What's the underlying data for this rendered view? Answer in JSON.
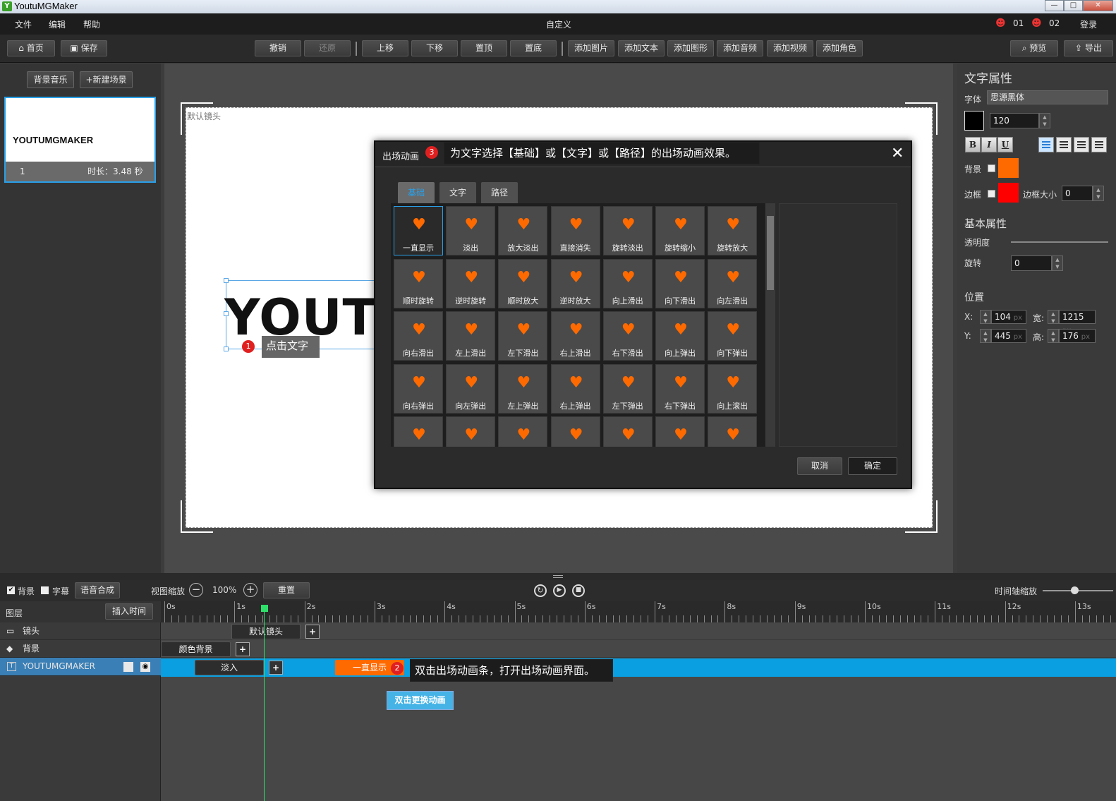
{
  "window": {
    "title": "YoutuMGMaker",
    "icon": "app-icon"
  },
  "menubar": {
    "items": [
      "文件",
      "编辑",
      "帮助"
    ],
    "center_title": "自定义",
    "user1": "01",
    "user2": "02",
    "login": "登录"
  },
  "toolbar": {
    "home": "首页",
    "save": "保存",
    "undo": "撤销",
    "redo": "还原",
    "move_up": "上移",
    "move_down": "下移",
    "to_top": "置顶",
    "to_bottom": "置底",
    "add_image": "添加图片",
    "add_text": "添加文本",
    "add_shape": "添加图形",
    "add_audio": "添加音频",
    "add_video": "添加视频",
    "add_character": "添加角色",
    "preview": "预览",
    "export": "导出"
  },
  "left": {
    "bg_music": "背景音乐",
    "new_scene": "+新建场景",
    "scene_text": "YOUTUMGMAKER",
    "scene_index": "1",
    "scene_duration": "时长：3.48 秒"
  },
  "stage": {
    "camera_label": "默认镜头",
    "text_content": "YOUTU",
    "tip1_num": "1",
    "tip1": "点击文字"
  },
  "dialog": {
    "title": "出场动画",
    "tip3_num": "3",
    "tip3": "为文字选择【基础】或【文字】或【路径】的出场动画效果。",
    "tabs": [
      "基础",
      "文字",
      "路径"
    ],
    "cells": [
      "一直显示",
      "淡出",
      "放大淡出",
      "直接消失",
      "旋转淡出",
      "旋转缩小",
      "旋转放大",
      "顺时旋转",
      "逆时旋转",
      "顺时放大",
      "逆时放大",
      "向上滑出",
      "向下滑出",
      "向左滑出",
      "向右滑出",
      "左上滑出",
      "左下滑出",
      "右上滑出",
      "右下滑出",
      "向上弹出",
      "向下弹出",
      "向右弹出",
      "向左弹出",
      "左上弹出",
      "右上弹出",
      "左下弹出",
      "右下弹出",
      "向上滚出",
      "",
      "",
      "",
      "",
      "",
      "",
      ""
    ],
    "cancel": "取消",
    "ok": "确定"
  },
  "right": {
    "title": "文字属性",
    "font_label": "字体",
    "font_value": "思源黑体",
    "size": "120",
    "bold": "B",
    "italic": "I",
    "underline": "U",
    "bg_label": "背景",
    "border_label": "边框",
    "border_size_label": "边框大小",
    "border_size": "0",
    "basic_title": "基本属性",
    "opacity_label": "透明度",
    "rotate_label": "旋转",
    "rotate": "0",
    "position_title": "位置",
    "x_label": "X:",
    "x": "104",
    "y_label": "Y:",
    "y": "445",
    "w_label": "宽:",
    "w": "1215",
    "h_label": "高:",
    "h": "176",
    "unit": "px",
    "bg_color": "#ff6a00",
    "border_color": "#ff0000",
    "text_color": "#000000"
  },
  "timeline": {
    "bg_check": "背景",
    "subtitle_check": "字幕",
    "tts": "语音合成",
    "zoom_label": "视图缩放",
    "zoom": "100%",
    "reset": "重置",
    "timescale": "时间轴缩放",
    "layers_label": "图层",
    "insert_time": "插入时间",
    "ticks": [
      "0s",
      "1s",
      "2s",
      "3s",
      "4s",
      "5s",
      "6s",
      "7s",
      "8s",
      "9s",
      "10s",
      "11s",
      "12s",
      "13s"
    ],
    "rows": [
      {
        "name": "镜头",
        "clip": "默认镜头"
      },
      {
        "name": "背景",
        "clip": "颜色背景"
      },
      {
        "name": "YOUTUMGMAKER",
        "clip": "淡入",
        "exit_clip": "一直显示"
      }
    ],
    "tip2_num": "2",
    "tip2": "双击出场动画条，打开出场动画界面。",
    "hint": "双击更换动画"
  }
}
